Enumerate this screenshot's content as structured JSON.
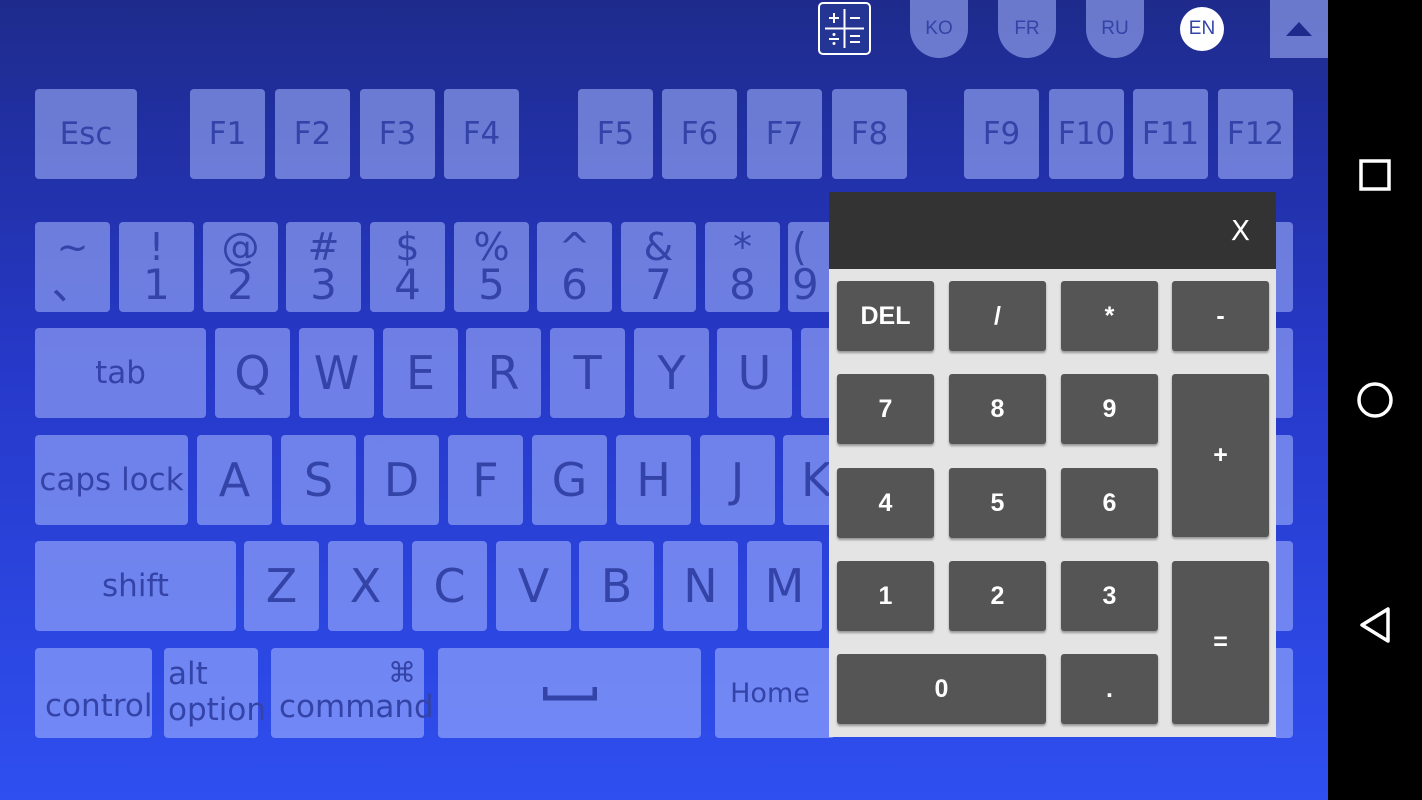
{
  "lang_bar": {
    "calculator_icon": "calculator-icon",
    "languages": [
      "KO",
      "FR",
      "RU",
      "EN"
    ],
    "active": "EN",
    "collapse_icon": "triangle-up-icon"
  },
  "function_row": [
    "Esc",
    "F1",
    "F2",
    "F3",
    "F4",
    "F5",
    "F6",
    "F7",
    "F8",
    "F9",
    "F10",
    "F11",
    "F12"
  ],
  "number_row": [
    {
      "top": "~",
      "bottom": "、"
    },
    {
      "top": "!",
      "bottom": "1"
    },
    {
      "top": "@",
      "bottom": "2"
    },
    {
      "top": "#",
      "bottom": "3"
    },
    {
      "top": "$",
      "bottom": "4"
    },
    {
      "top": "%",
      "bottom": "5"
    },
    {
      "top": "^",
      "bottom": "6"
    },
    {
      "top": "&",
      "bottom": "7"
    },
    {
      "top": "*",
      "bottom": "8"
    },
    {
      "top": "(",
      "bottom": "9"
    }
  ],
  "qwerty_row": [
    "tab",
    "Q",
    "W",
    "E",
    "R",
    "T",
    "Y",
    "U"
  ],
  "home_row": [
    "caps lock",
    "A",
    "S",
    "D",
    "F",
    "G",
    "H",
    "J",
    "K"
  ],
  "shift_row": [
    "shift",
    "Z",
    "X",
    "C",
    "V",
    "B",
    "N",
    "M"
  ],
  "bottom_row": {
    "control": "control",
    "alt_top": "alt",
    "alt_bottom": "option",
    "command_symbol": "⌘",
    "command": "command",
    "space_icon": "space-bar-icon",
    "home": "Home"
  },
  "calculator": {
    "display": "",
    "close": "X",
    "buttons": {
      "del": "DEL",
      "div": "/",
      "mul": "*",
      "minus": "-",
      "n7": "7",
      "n8": "8",
      "n9": "9",
      "plus": "+",
      "n4": "4",
      "n5": "5",
      "n6": "6",
      "n1": "1",
      "n2": "2",
      "n3": "3",
      "equals": "=",
      "n0": "0",
      "dot": "."
    }
  },
  "navbar": {
    "icons": [
      "square-icon",
      "circle-icon",
      "back-triangle-icon"
    ]
  }
}
